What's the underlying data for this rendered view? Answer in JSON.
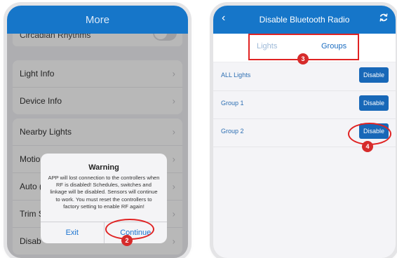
{
  "left": {
    "header_title": "More",
    "cut_row_label": "Circadian Rhythms",
    "group1": [
      {
        "label": "Light Info",
        "chevron": "›"
      },
      {
        "label": "Device Info",
        "chevron": "›"
      }
    ],
    "group2": [
      {
        "label": "Nearby Lights",
        "chevron": "›"
      },
      {
        "label": "Motio",
        "chevron": "›"
      },
      {
        "label": "Auto (",
        "chevron": "›"
      },
      {
        "label": "Trim S",
        "chevron": "›"
      },
      {
        "label": "Disab",
        "chevron": "›"
      }
    ],
    "dialog": {
      "title": "Warning",
      "message": "APP will lost connection to the controllers when RF is disabled! Schedules, switches and linkage will be disabled. Sensors will continue to work. You must reset the controllers to factory setting to enable RF again!",
      "exit_label": "Exit",
      "continue_label": "Continue"
    },
    "badge": "2"
  },
  "right": {
    "back_icon": "‹",
    "header_title": "Disable Bluetooth Radio",
    "tabs": {
      "lights": "Lights",
      "groups": "Groups"
    },
    "badge_tabs": "3",
    "items": [
      {
        "label": "ALL Lights",
        "button": "Disable"
      },
      {
        "label": "Group 1",
        "button": "Disable"
      },
      {
        "label": "Group 2",
        "button": "Disable"
      }
    ],
    "badge_button": "4"
  },
  "colors": {
    "accent": "#1676c9",
    "annotation": "#e02323"
  }
}
